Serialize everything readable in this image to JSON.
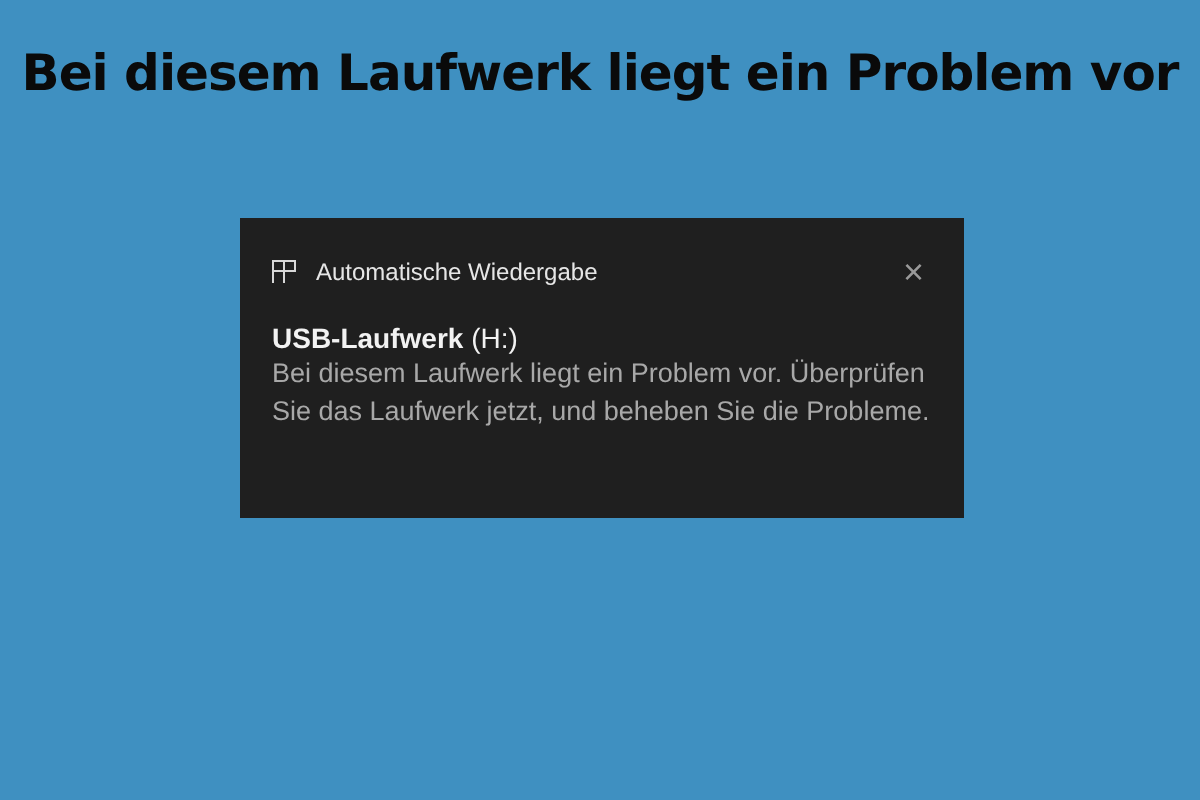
{
  "headline": "Bei diesem Laufwerk liegt ein Problem vor",
  "notification": {
    "app_name": "Automatische Wiedergabe",
    "close": "×",
    "title": "**USB-Laufwerk** (H:)",
    "message": "Bei diesem Laufwerk liegt ein Problem vor. Überprüfen Sie das Laufwerk jetzt, und beheben Sie die Probleme."
  }
}
